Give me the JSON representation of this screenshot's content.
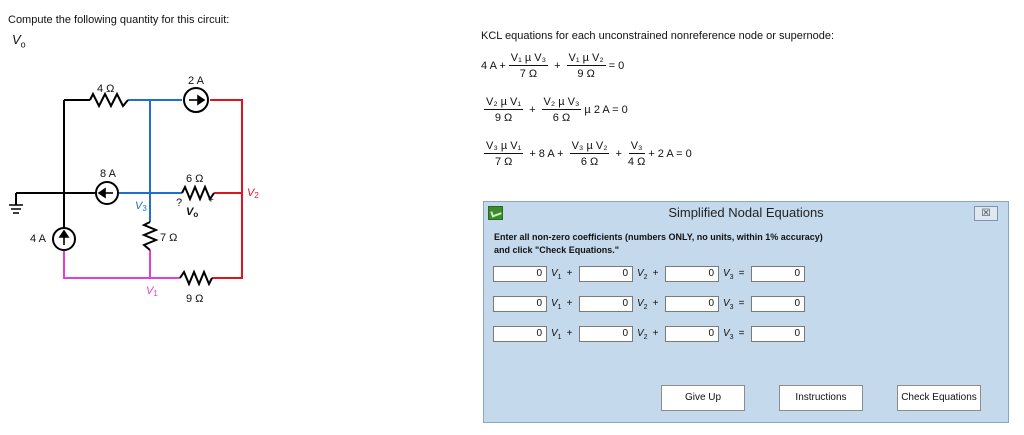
{
  "question": {
    "title": "Compute the following quantity for this circuit:",
    "var_name": "V",
    "var_sub": "o"
  },
  "circuit": {
    "labels": {
      "r4": "4 Ω",
      "r7": "7 Ω",
      "r6": "6 Ω",
      "r9": "9 Ω",
      "s2a": "2 A",
      "s8a": "8 A",
      "s4a": "4 A",
      "v1": "V",
      "v1_sub": "1",
      "v2": "V",
      "v2_sub": "2",
      "v3": "V",
      "v3_sub": "3",
      "vo_q": "?",
      "vo": "V",
      "vo_sub": "o",
      "vo_plus": "+"
    },
    "colors": {
      "wire": "#000000",
      "blue": "#1f6fd1",
      "red": "#e0141e",
      "magenta": "#e040d8"
    }
  },
  "kcl": {
    "title": "KCL equations for each unconstrained nonreference node or supernode:",
    "eq1": {
      "lead": "4 A +",
      "f1_num": "V₁ µ V₃",
      "f1_den": "7 Ω",
      "plus1": "+",
      "f2_num": "V₁ µ V₂",
      "f2_den": "9 Ω",
      "tail": "= 0"
    },
    "eq2": {
      "f1_num": "V₂ µ V₁",
      "f1_den": "9 Ω",
      "plus1": "+",
      "f2_num": "V₂ µ V₃",
      "f2_den": "6 Ω",
      "tail": "µ 2 A = 0"
    },
    "eq3": {
      "f1_num": "V₃ µ V₁",
      "f1_den": "7 Ω",
      "mid": "+ 8 A +",
      "f2_num": "V₃ µ V₂",
      "f2_den": "6 Ω",
      "plus2": "+",
      "f3_num": "V₃",
      "f3_den": "4 Ω",
      "tail": "+ 2 A = 0"
    }
  },
  "dialog": {
    "title": "Simplified Nodal Equations",
    "close": "☒",
    "instructions": "Enter all non-zero coefficients (numbers ONLY, no units, within 1% accuracy) and click \"Check Equations.\"",
    "rows": [
      {
        "c1": "0",
        "c2": "0",
        "c3": "0",
        "rhs": "0"
      },
      {
        "c1": "0",
        "c2": "0",
        "c3": "0",
        "rhs": "0"
      },
      {
        "c1": "0",
        "c2": "0",
        "c3": "0",
        "rhs": "0"
      }
    ],
    "var_v": "V",
    "sub1": "1",
    "sub2": "2",
    "sub3": "3",
    "plus": "+",
    "equals": "=",
    "buttons": {
      "give_up": "Give Up",
      "instructions": "Instructions",
      "check": "Check Equations"
    }
  }
}
